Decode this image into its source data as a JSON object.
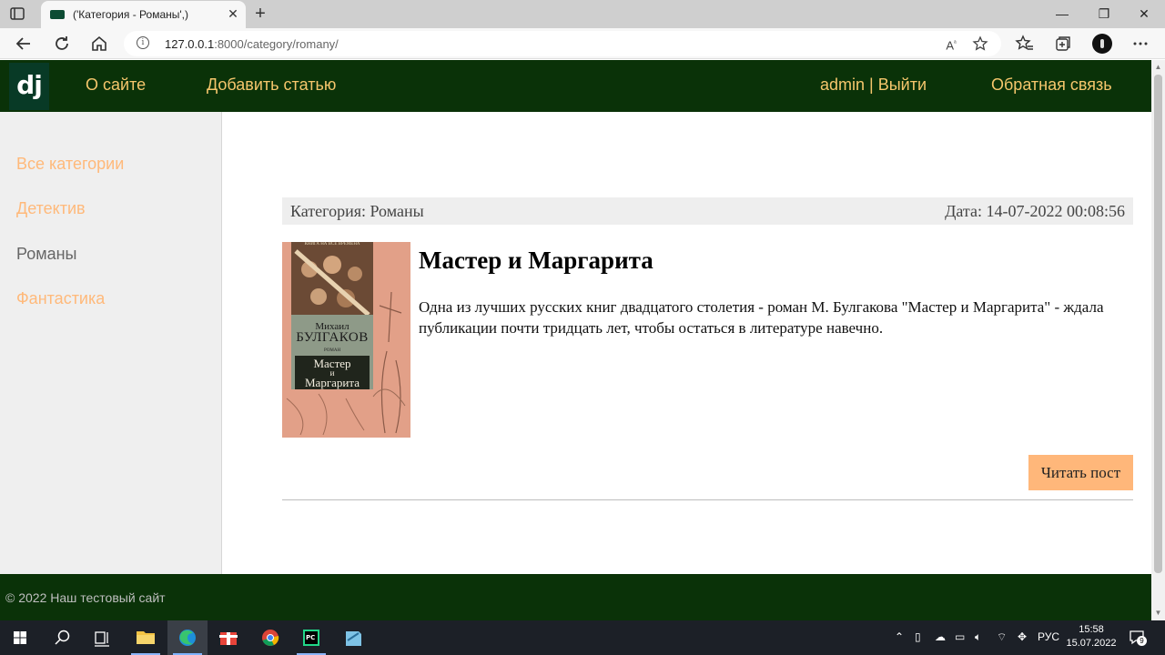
{
  "browser": {
    "tab_title": "('Категория - Романы',)",
    "tab_close": "✕",
    "new_tab": "+",
    "url_host": "127.0.0.1",
    "url_path": ":8000/category/romany/",
    "window_controls": {
      "minimize": "—",
      "restore": "❐",
      "close": "✕"
    },
    "toolbar_icons": [
      "back-icon",
      "refresh-icon",
      "home-icon",
      "read-aloud-icon",
      "favorite-add-icon",
      "favorites-icon",
      "collections-icon",
      "profile-icon",
      "more-icon"
    ]
  },
  "site": {
    "logo": "dj",
    "nav": {
      "about": "О сайте",
      "add_article": "Добавить статью",
      "user": "admin | Выйти",
      "feedback": "Обратная связь"
    },
    "sidebar": {
      "categories": [
        {
          "label": "Все категории",
          "active": false
        },
        {
          "label": "Детектив",
          "active": false
        },
        {
          "label": "Романы",
          "active": true
        },
        {
          "label": "Фантастика",
          "active": false
        }
      ]
    },
    "post": {
      "category": "Категория: Романы",
      "date": "Дата: 14-07-2022 00:08:56",
      "title": "Мастер и Маргарита",
      "text": "Одна из лучших русских книг двадцатого столетия - роман М. Булгакова \"Мастер и Маргарита\" - ждала публикации почти тридцать лет, чтобы остаться в литературе навечно.",
      "read_button": "Читать пост",
      "cover": {
        "series": "КНИГА НА ВСЕ ВРЕМЕНА",
        "author_first": "Михаил",
        "author_last": "БУЛГАКОВ",
        "genre": "РОМАН",
        "title_line1": "Мастер",
        "title_line2": "и",
        "title_line3": "Маргарита"
      }
    },
    "footer": "© 2022 Наш тестовый сайт"
  },
  "taskbar": {
    "language": "РУС",
    "time": "15:58",
    "date": "15.07.2022",
    "notifications": "9"
  },
  "colors": {
    "header_bg": "#0a3208",
    "nav_link": "#f5c66c",
    "category_link": "#ffb97a",
    "button_bg": "#ffb77a"
  }
}
